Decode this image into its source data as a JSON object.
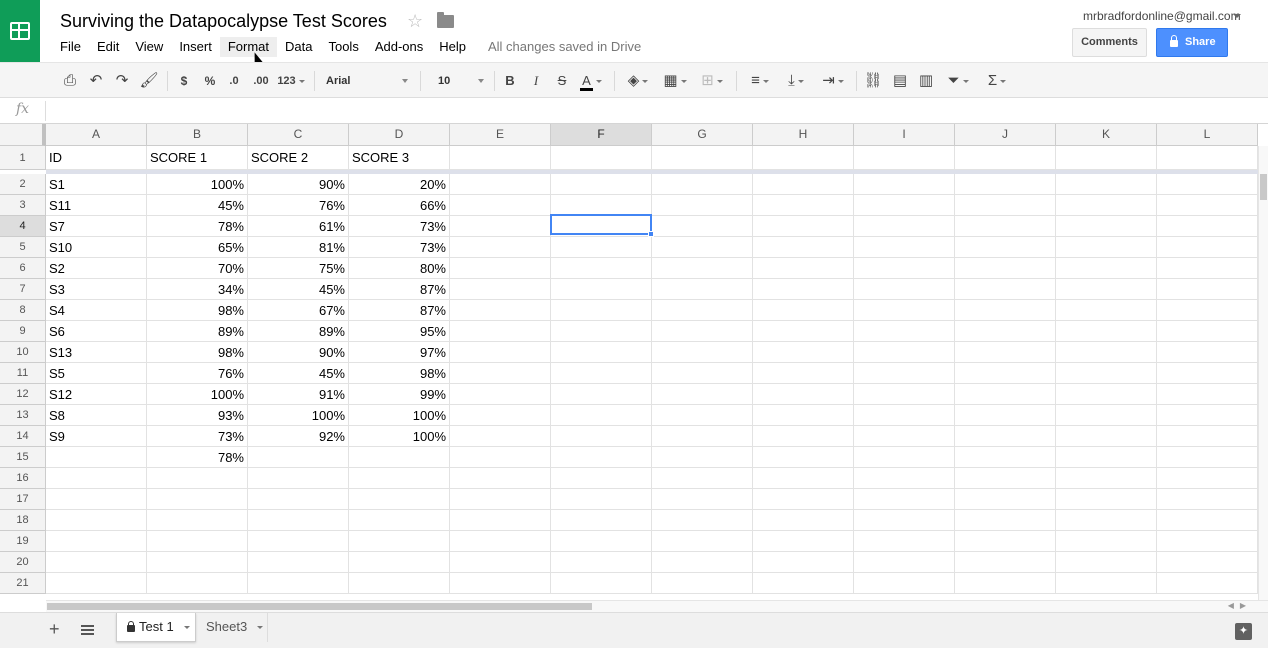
{
  "header": {
    "title": "Surviving the Datapocalypse Test Scores",
    "save_status": "All changes saved in Drive",
    "account_email": "mrbradfordonline@gmail.com",
    "comments_label": "Comments",
    "share_label": "Share"
  },
  "menu": [
    "File",
    "Edit",
    "View",
    "Insert",
    "Format",
    "Data",
    "Tools",
    "Add-ons",
    "Help"
  ],
  "toolbar": {
    "currency": "$",
    "percent": "%",
    "decrease_decimal": ".0",
    "increase_decimal": ".00",
    "more_formats": "123",
    "font": "Arial",
    "font_size": "10",
    "bold": "B",
    "italic": "I",
    "strikethrough": "S",
    "text_color": "A",
    "sum": "Σ"
  },
  "formula_bar": {
    "fx_label": "fx"
  },
  "sheet": {
    "columns": [
      "A",
      "B",
      "C",
      "D",
      "E",
      "F",
      "G",
      "H",
      "I",
      "J",
      "K",
      "L"
    ],
    "row_numbers": [
      "1",
      "2",
      "3",
      "4",
      "5",
      "6",
      "7",
      "8",
      "9",
      "10",
      "11",
      "12",
      "13",
      "14",
      "15",
      "16",
      "17",
      "18",
      "19",
      "20",
      "21"
    ],
    "rows": [
      [
        "ID",
        "SCORE 1",
        "SCORE 2",
        "SCORE 3"
      ],
      [
        "S1",
        "100%",
        "90%",
        "20%"
      ],
      [
        "S11",
        "45%",
        "76%",
        "66%"
      ],
      [
        "S7",
        "78%",
        "61%",
        "73%"
      ],
      [
        "S10",
        "65%",
        "81%",
        "73%"
      ],
      [
        "S2",
        "70%",
        "75%",
        "80%"
      ],
      [
        "S3",
        "34%",
        "45%",
        "87%"
      ],
      [
        "S4",
        "98%",
        "67%",
        "87%"
      ],
      [
        "S6",
        "89%",
        "89%",
        "95%"
      ],
      [
        "S13",
        "98%",
        "90%",
        "97%"
      ],
      [
        "S5",
        "76%",
        "45%",
        "98%"
      ],
      [
        "S12",
        "100%",
        "91%",
        "99%"
      ],
      [
        "S8",
        "93%",
        "100%",
        "100%"
      ],
      [
        "S9",
        "73%",
        "92%",
        "100%"
      ],
      [
        "",
        "78%",
        "",
        ""
      ]
    ],
    "selected_cell": "F4",
    "selected_column": "F",
    "selected_row": "4"
  },
  "tabs": {
    "sheets": [
      "Test 1",
      "Sheet3"
    ],
    "active": "Test 1"
  },
  "colors": {
    "brand": "#0f9d58",
    "share": "#4d90fe",
    "selection": "#4285f4"
  }
}
